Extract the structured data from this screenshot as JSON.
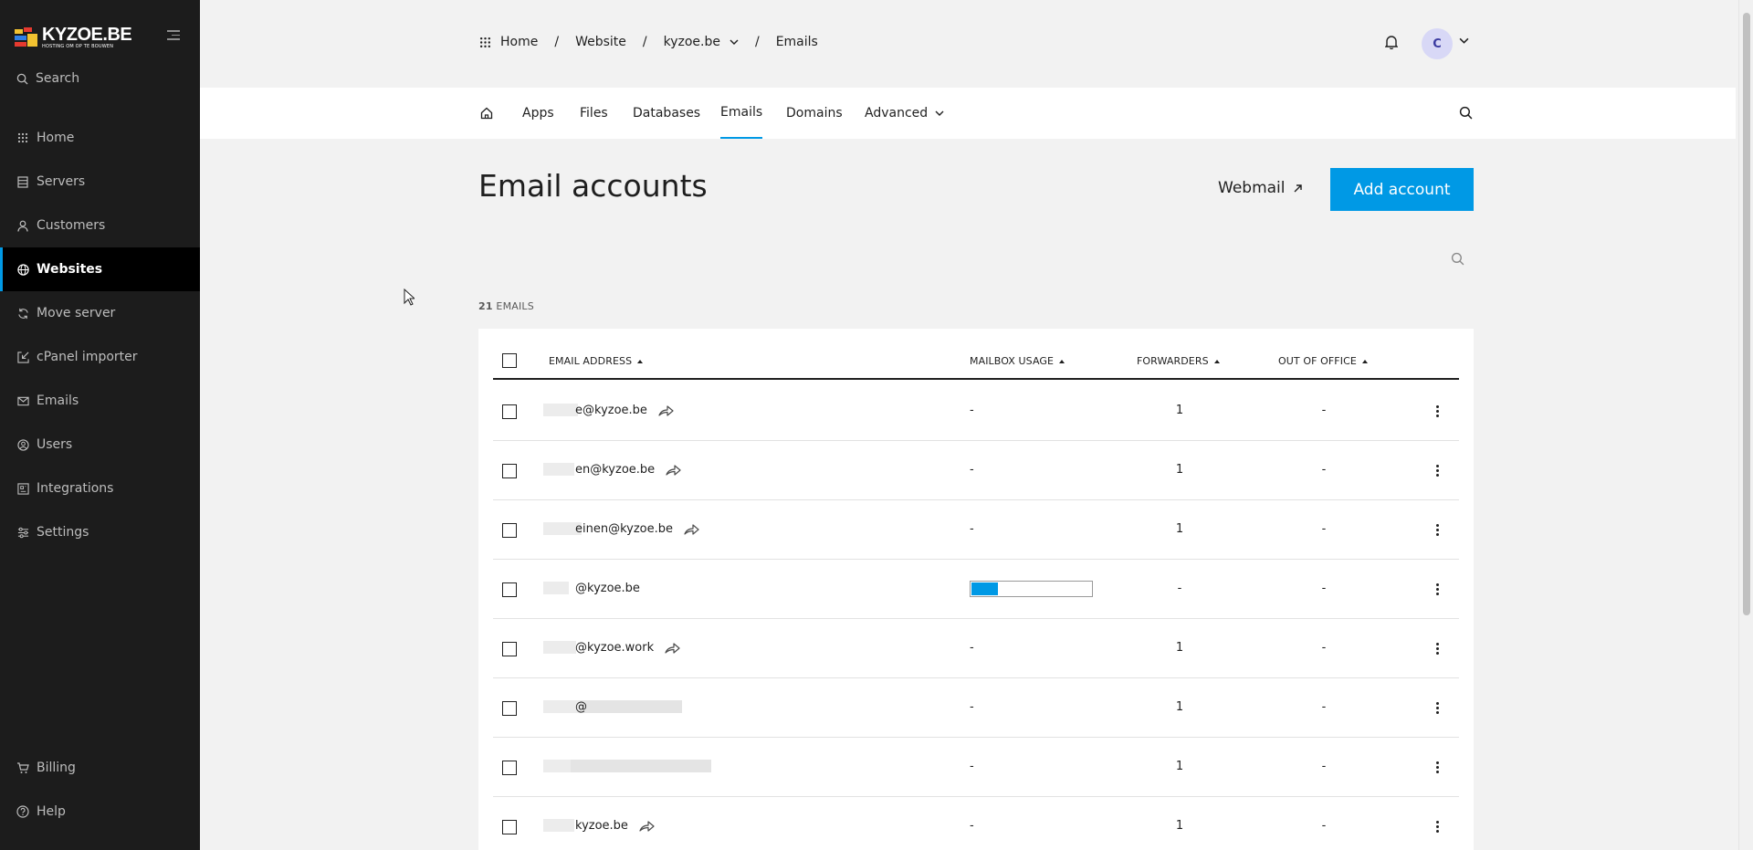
{
  "brand": {
    "name": "KYZOE.BE",
    "tagline": "HOSTING OM OP TE BOUWEN"
  },
  "sidebar": {
    "search_label": "Search",
    "items": [
      {
        "label": "Home",
        "icon": "grid-icon"
      },
      {
        "label": "Servers",
        "icon": "server-icon"
      },
      {
        "label": "Customers",
        "icon": "user-icon"
      },
      {
        "label": "Websites",
        "icon": "globe-icon",
        "active": true
      },
      {
        "label": "Move server",
        "icon": "refresh-icon"
      },
      {
        "label": "cPanel importer",
        "icon": "import-icon"
      },
      {
        "label": "Emails",
        "icon": "mail-icon"
      },
      {
        "label": "Users",
        "icon": "user-circle-icon"
      },
      {
        "label": "Integrations",
        "icon": "integrations-icon"
      },
      {
        "label": "Settings",
        "icon": "sliders-icon"
      }
    ],
    "bottom_items": [
      {
        "label": "Billing",
        "icon": "cart-icon"
      },
      {
        "label": "Help",
        "icon": "help-icon"
      }
    ]
  },
  "breadcrumb": {
    "items": [
      "Home",
      "Website",
      "kyzoe.be",
      "Emails"
    ],
    "separator": "/"
  },
  "user": {
    "initial": "C"
  },
  "tabs": [
    {
      "label": "Apps"
    },
    {
      "label": "Files"
    },
    {
      "label": "Databases"
    },
    {
      "label": "Emails",
      "active": true
    },
    {
      "label": "Domains"
    },
    {
      "label": "Advanced",
      "dropdown": true
    }
  ],
  "page": {
    "title": "Email accounts",
    "webmail_label": "Webmail",
    "add_account_label": "Add account",
    "count_number": "21",
    "count_label": "EMAILS"
  },
  "table": {
    "columns": [
      "EMAIL ADDRESS",
      "MAILBOX USAGE",
      "FORWARDERS",
      "OUT OF OFFICE"
    ],
    "rows": [
      {
        "email": "e@kyzoe.be",
        "forward_icon": true,
        "usage": "-",
        "usage_fraction": null,
        "forwarders": "1",
        "out_of_office": "-"
      },
      {
        "email": "en@kyzoe.be",
        "forward_icon": true,
        "usage": "-",
        "usage_fraction": null,
        "forwarders": "1",
        "out_of_office": "-"
      },
      {
        "email": "einen@kyzoe.be",
        "forward_icon": true,
        "usage": "-",
        "usage_fraction": null,
        "forwarders": "1",
        "out_of_office": "-"
      },
      {
        "email": "@kyzoe.be",
        "forward_icon": false,
        "usage": "",
        "usage_fraction": 0.22,
        "forwarders": "-",
        "out_of_office": "-"
      },
      {
        "email": "@kyzoe.work",
        "forward_icon": true,
        "usage": "-",
        "usage_fraction": null,
        "forwarders": "1",
        "out_of_office": "-"
      },
      {
        "email": "@",
        "forward_icon": false,
        "usage": "-",
        "usage_fraction": null,
        "forwarders": "1",
        "out_of_office": "-"
      },
      {
        "email": "",
        "forward_icon": false,
        "usage": "-",
        "usage_fraction": null,
        "forwarders": "1",
        "out_of_office": "-"
      },
      {
        "email": "kyzoe.be",
        "forward_icon": true,
        "usage": "-",
        "usage_fraction": null,
        "forwarders": "1",
        "out_of_office": "-"
      }
    ]
  },
  "colors": {
    "accent": "#0099e5",
    "sidebar_bg": "#1c1c1c",
    "active_bg": "#000000"
  }
}
